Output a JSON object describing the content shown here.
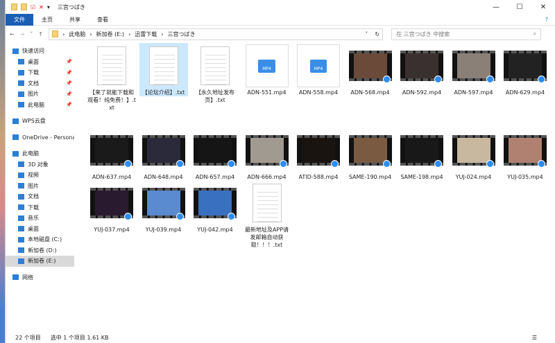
{
  "window": {
    "title": "三宫つばき",
    "minimize": "—",
    "maximize": "☐",
    "close": "✕"
  },
  "ribbon": {
    "tabs": [
      "文件",
      "主页",
      "共享",
      "查看"
    ],
    "help": "?"
  },
  "address": {
    "crumbs": [
      "此电脑",
      "新加卷 (E:)",
      "迅雷下载",
      "三宫つばき"
    ],
    "search_placeholder": "在 三宫つばき 中搜索"
  },
  "nav": {
    "items": [
      {
        "label": "快速访问",
        "type": "head",
        "pin": false
      },
      {
        "label": "桌面",
        "type": "sub",
        "pin": true
      },
      {
        "label": "下载",
        "type": "sub",
        "pin": true
      },
      {
        "label": "文档",
        "type": "sub",
        "pin": true
      },
      {
        "label": "图片",
        "type": "sub",
        "pin": true
      },
      {
        "label": "此电脑",
        "type": "sub",
        "pin": true
      },
      {
        "label": "WPS云盘",
        "type": "head",
        "pin": false
      },
      {
        "label": "OneDrive - Persona",
        "type": "head",
        "pin": false
      },
      {
        "label": "此电脑",
        "type": "head",
        "pin": false
      },
      {
        "label": "3D 对象",
        "type": "sub",
        "pin": false
      },
      {
        "label": "视频",
        "type": "sub",
        "pin": false
      },
      {
        "label": "图片",
        "type": "sub",
        "pin": false
      },
      {
        "label": "文档",
        "type": "sub",
        "pin": false
      },
      {
        "label": "下载",
        "type": "sub",
        "pin": false
      },
      {
        "label": "音乐",
        "type": "sub",
        "pin": false
      },
      {
        "label": "桌面",
        "type": "sub",
        "pin": false
      },
      {
        "label": "本地磁盘 (C:)",
        "type": "sub",
        "pin": false
      },
      {
        "label": "新加卷 (D:)",
        "type": "sub",
        "pin": false
      },
      {
        "label": "新加卷 (E:)",
        "type": "sub",
        "pin": false,
        "selected": true
      },
      {
        "label": "网络",
        "type": "head",
        "pin": false
      }
    ]
  },
  "files": [
    {
      "name": "【来了就能下载和观看！纯免费！】.txt",
      "kind": "txt"
    },
    {
      "name": "【论坛介绍】.txt",
      "kind": "txt",
      "selected": true
    },
    {
      "name": "【永久地址发布页】.txt",
      "kind": "txt"
    },
    {
      "name": "ADN-551.mp4",
      "kind": "mp4"
    },
    {
      "name": "ADN-558.mp4",
      "kind": "mp4"
    },
    {
      "name": "ADN-568.mp4",
      "kind": "video",
      "color": "#6b4a3a"
    },
    {
      "name": "ADN-592.mp4",
      "kind": "video",
      "color": "#3a3030"
    },
    {
      "name": "ADN-597.mp4",
      "kind": "video",
      "color": "#8a8078"
    },
    {
      "name": "ADN-629.mp4",
      "kind": "video",
      "color": "#222"
    },
    {
      "name": "ADN-637.mp4",
      "kind": "video",
      "color": "#1a1a1a"
    },
    {
      "name": "ADN-648.mp4",
      "kind": "video",
      "color": "#2a2a3a"
    },
    {
      "name": "ADN-657.mp4",
      "kind": "video",
      "color": "#151515"
    },
    {
      "name": "ADN-666.mp4",
      "kind": "video",
      "color": "#a09a90"
    },
    {
      "name": "ATID-588.mp4",
      "kind": "video",
      "color": "#1a1410"
    },
    {
      "name": "SAME-190.mp4",
      "kind": "video",
      "color": "#7a5a40"
    },
    {
      "name": "SAME-198.mp4",
      "kind": "video",
      "color": "#181818"
    },
    {
      "name": "YUJ-024.mp4",
      "kind": "video",
      "color": "#c8b8a0"
    },
    {
      "name": "YUJ-035.mp4",
      "kind": "video",
      "color": "#b08070"
    },
    {
      "name": "YUJ-037.mp4",
      "kind": "video",
      "color": "#2a1a30"
    },
    {
      "name": "YUJ-039.mp4",
      "kind": "video",
      "color": "#5a8ad0"
    },
    {
      "name": "YUJ-042.mp4",
      "kind": "video",
      "color": "#3a70c0"
    },
    {
      "name": "最新地址及APP请发邮箱自动获取！！！.txt",
      "kind": "txt"
    }
  ],
  "status": {
    "count": "22 个项目",
    "selection": "选中 1 个项目  1.61 KB"
  }
}
